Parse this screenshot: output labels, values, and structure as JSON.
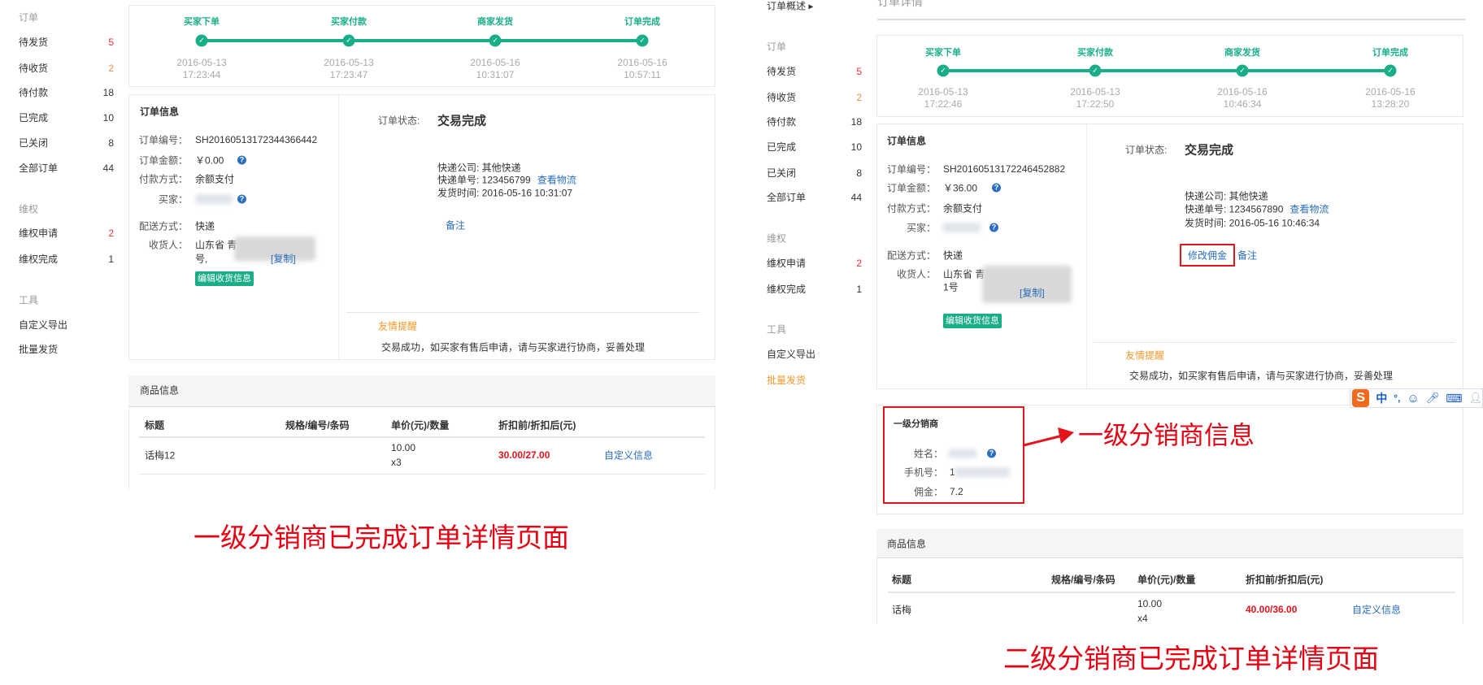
{
  "colors": {
    "accent_green": "#1aae88",
    "count_red": "#e3343c",
    "count_orange": "#f08a4b",
    "link_blue": "#2a6ebb",
    "annotation_red": "#e60012"
  },
  "pages": [
    {
      "sidebar": [
        {
          "title": "订单",
          "items": [
            {
              "label": "待发货",
              "count": "5",
              "count_color": "#e3343c"
            },
            {
              "label": "待收货",
              "count": "2",
              "count_color": "#f08a4b"
            },
            {
              "label": "待付款",
              "count": "18",
              "count_color": "#333333"
            },
            {
              "label": "已完成",
              "count": "10",
              "count_color": "#333333"
            },
            {
              "label": "已关闭",
              "count": "8",
              "count_color": "#333333"
            },
            {
              "label": "全部订单",
              "count": "44",
              "count_color": "#333333"
            }
          ]
        },
        {
          "title": "维权",
          "items": [
            {
              "label": "维权申请",
              "count": "2",
              "count_color": "#e3343c"
            },
            {
              "label": "维权完成",
              "count": "1",
              "count_color": "#333333"
            }
          ]
        },
        {
          "title": "工具",
          "items": [
            {
              "label": "自定义导出"
            },
            {
              "label": "批量发货"
            }
          ]
        }
      ],
      "timeline": [
        {
          "label": "买家下单",
          "date": "2016-05-13",
          "time": "17:23:44"
        },
        {
          "label": "买家付款",
          "date": "2016-05-13",
          "time": "17:23:47"
        },
        {
          "label": "商家发货",
          "date": "2016-05-16",
          "time": "10:31:07"
        },
        {
          "label": "订单完成",
          "date": "2016-05-16",
          "time": "10:57:11"
        }
      ],
      "order_info": {
        "title": "订单信息",
        "order_no_label": "订单编号：",
        "order_no": "SH20160513172344366442",
        "amount_label": "订单金额：",
        "amount": "￥0.00",
        "pay_label": "付款方式：",
        "pay": "余额支付",
        "buyer_label": "买家：",
        "delivery_label": "配送方式：",
        "delivery": "快递",
        "receiver_label": "收货人：",
        "receiver_line1": "山东省 青",
        "receiver_line2": "号,",
        "copy_link": "[复制]",
        "edit_button": "编辑收货信息"
      },
      "status": {
        "label": "订单状态:",
        "value": "交易完成",
        "company": "快递公司: 其他快递",
        "tracking_label": "快递单号: 123456799",
        "track_link": "查看物流",
        "ship_time": "发货时间: 2016-05-16 10:31:07",
        "remark": "备注",
        "tip_title": "友情提醒",
        "tip_text": "交易成功，如买家有售后申请，请与买家进行协商，妥善处理"
      },
      "products": {
        "title": "商品信息",
        "columns": [
          "标题",
          "规格/编号/条码",
          "单价(元)/数量",
          "折扣前/折扣后(元)"
        ],
        "rows": [
          {
            "title": "话梅12",
            "price": "10.00",
            "qty": "x3",
            "amount": "30.00/27.00",
            "link": "自定义信息"
          }
        ]
      },
      "caption": "一级分销商已完成订单详情页面"
    },
    {
      "breadcrumb": "订单概述 ▸",
      "page_title": "订单详情",
      "sidebar": [
        {
          "title": "订单",
          "items": [
            {
              "label": "待发货",
              "count": "5",
              "count_color": "#e3343c"
            },
            {
              "label": "待收货",
              "count": "2",
              "count_color": "#f08a4b"
            },
            {
              "label": "待付款",
              "count": "18",
              "count_color": "#333333"
            },
            {
              "label": "已完成",
              "count": "10",
              "count_color": "#333333"
            },
            {
              "label": "已关闭",
              "count": "8",
              "count_color": "#333333"
            },
            {
              "label": "全部订单",
              "count": "44",
              "count_color": "#333333"
            }
          ]
        },
        {
          "title": "维权",
          "items": [
            {
              "label": "维权申请",
              "count": "2",
              "count_color": "#e3343c"
            },
            {
              "label": "维权完成",
              "count": "1",
              "count_color": "#333333"
            }
          ]
        },
        {
          "title": "工具",
          "items": [
            {
              "label": "自定义导出"
            },
            {
              "label": "批量发货",
              "active": true
            }
          ]
        }
      ],
      "timeline": [
        {
          "label": "买家下单",
          "date": "2016-05-13",
          "time": "17:22:46"
        },
        {
          "label": "买家付款",
          "date": "2016-05-13",
          "time": "17:22:50"
        },
        {
          "label": "商家发货",
          "date": "2016-05-16",
          "time": "10:46:34"
        },
        {
          "label": "订单完成",
          "date": "2016-05-16",
          "time": "13:28:20"
        }
      ],
      "order_info": {
        "title": "订单信息",
        "order_no_label": "订单编号：",
        "order_no": "SH20160513172246452882",
        "amount_label": "订单金额：",
        "amount": "￥36.00",
        "pay_label": "付款方式：",
        "pay": "余额支付",
        "buyer_label": "买家：",
        "delivery_label": "配送方式：",
        "delivery": "快递",
        "receiver_label": "收货人：",
        "receiver_line1": "山东省 青",
        "receiver_line2": "1号",
        "copy_link": "[复制]",
        "edit_button": "编辑收货信息"
      },
      "status": {
        "label": "订单状态:",
        "value": "交易完成",
        "company": "快递公司: 其他快递",
        "tracking_label": "快递单号: 1234567890",
        "track_link": "查看物流",
        "ship_time": "发货时间: 2016-05-16 10:46:34",
        "commission_button": "修改佣金",
        "remark": "备注",
        "tip_title": "友情提醒",
        "tip_text": "交易成功，如买家有售后申请，请与买家进行协商，妥善处理"
      },
      "distributor": {
        "title": "一级分销商",
        "name_label": "姓名：",
        "phone_label": "手机号：",
        "phone_prefix": "1",
        "commission_label": "佣金：",
        "commission": "7.2",
        "annotation": "一级分销商信息"
      },
      "products": {
        "title": "商品信息",
        "columns": [
          "标题",
          "规格/编号/条码",
          "单价(元)/数量",
          "折扣前/折扣后(元)"
        ],
        "rows": [
          {
            "title": "话梅",
            "price": "10.00",
            "qty": "x4",
            "amount": "40.00/36.00",
            "link": "自定义信息"
          }
        ]
      },
      "caption": "二级分销商已完成订单详情页面"
    }
  ],
  "ime_toolbar": {
    "logo": "S",
    "mode": "中",
    "punct": "°,"
  }
}
